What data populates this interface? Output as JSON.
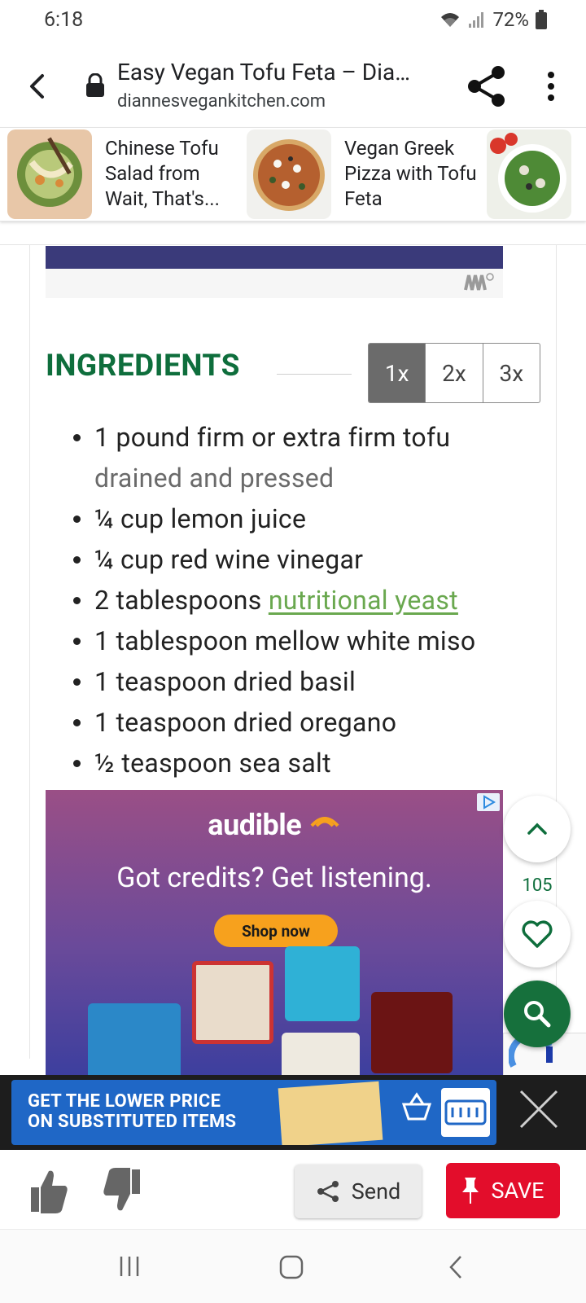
{
  "status_bar": {
    "time": "6:18",
    "battery": "72%"
  },
  "browser": {
    "page_title": "Easy Vegan Tofu Feta – Dia…",
    "url": "diannesvegankitchen.com"
  },
  "recommendations": [
    {
      "title": "Chinese Tofu Salad from Wait, That's..."
    },
    {
      "title": "Vegan Greek Pizza with Tofu Feta"
    }
  ],
  "ingredients": {
    "heading": "INGREDIENTS",
    "scale_options": [
      "1x",
      "2x",
      "3x"
    ],
    "scale_selected": "1x",
    "items": [
      {
        "text": "1 pound firm or extra firm tofu",
        "note": "drained and pressed"
      },
      {
        "text": "¼ cup lemon juice"
      },
      {
        "text": "¼ cup red wine vinegar"
      },
      {
        "text": "2 tablespoons ",
        "link": "nutritional yeast"
      },
      {
        "text": "1 tablespoon mellow white miso"
      },
      {
        "text": "1 teaspoon dried basil"
      },
      {
        "text": "1 teaspoon dried oregano"
      },
      {
        "text": "½ teaspoon sea salt"
      }
    ]
  },
  "audible_ad": {
    "logo": "audible",
    "headline": "Got credits? Get listening.",
    "cta": "Shop now"
  },
  "floating": {
    "like_count": "105"
  },
  "banner_ad": {
    "text_line1": "GET THE LOWER PRICE",
    "text_line2": "ON SUBSTITUTED ITEMS"
  },
  "actions": {
    "send_label": "Send",
    "save_label": "SAVE"
  },
  "colors": {
    "heading_green": "#0e6e3c",
    "link_green": "#6aa84f",
    "save_red": "#e30d2b",
    "search_fab": "#16703c"
  }
}
